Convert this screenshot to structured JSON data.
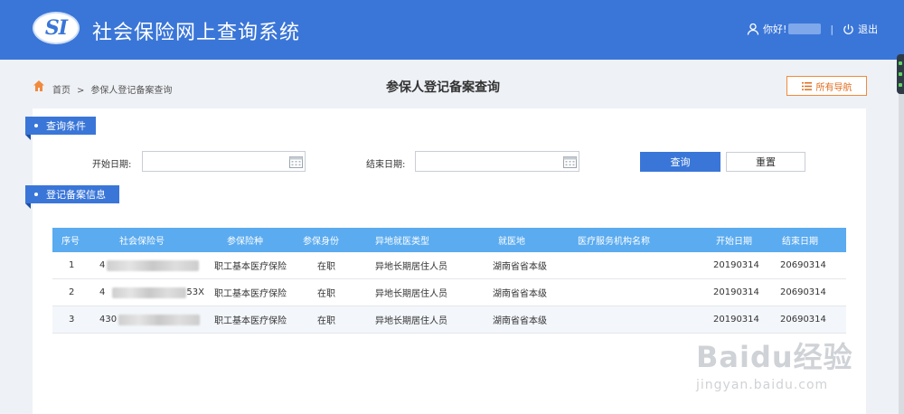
{
  "header": {
    "logo_text": "SI",
    "app_title": "社会保险网上查询系统",
    "greeting": "你好!",
    "logout_label": "退出",
    "separator": "|"
  },
  "breadcrumb": {
    "home": "首页",
    "arrow": ">",
    "current": "参保人登记备案查询"
  },
  "page_title": "参保人登记备案查询",
  "nav_button_label": "所有导航",
  "query_section": {
    "title": "查询条件",
    "start_date_label": "开始日期:",
    "start_date_value": "",
    "end_date_label": "结束日期:",
    "end_date_value": "",
    "query_button": "查询",
    "reset_button": "重置"
  },
  "info_section": {
    "title": "登记备案信息"
  },
  "table": {
    "columns": [
      "序号",
      "社会保险号",
      "参保险种",
      "参保身份",
      "异地就医类型",
      "就医地",
      "医疗服务机构名称",
      "开始日期",
      "结束日期"
    ],
    "rows": [
      {
        "no": "1",
        "ssn_prefix": "4",
        "ssn_suffix": "",
        "insurance": "职工基本医疗保险",
        "identity": "在职",
        "type": "异地长期居住人员",
        "place": "湖南省省本级",
        "institution": "",
        "start": "20190314",
        "end": "20690314"
      },
      {
        "no": "2",
        "ssn_prefix": "4",
        "ssn_suffix": "53X",
        "insurance": "职工基本医疗保险",
        "identity": "在职",
        "type": "异地长期居住人员",
        "place": "湖南省省本级",
        "institution": "",
        "start": "20190314",
        "end": "20690314"
      },
      {
        "no": "3",
        "ssn_prefix": "430",
        "ssn_suffix": "",
        "insurance": "职工基本医疗保险",
        "identity": "在职",
        "type": "异地长期居住人员",
        "place": "湖南省省本级",
        "institution": "",
        "start": "20190314",
        "end": "20690314"
      }
    ]
  },
  "watermark": {
    "brand": "Baidu经验",
    "url": "jingyan.baidu.com"
  },
  "colors": {
    "header_bg": "#3a76d8",
    "table_header_bg": "#5aabf0",
    "nav_button_accent": "#f08a3e"
  }
}
